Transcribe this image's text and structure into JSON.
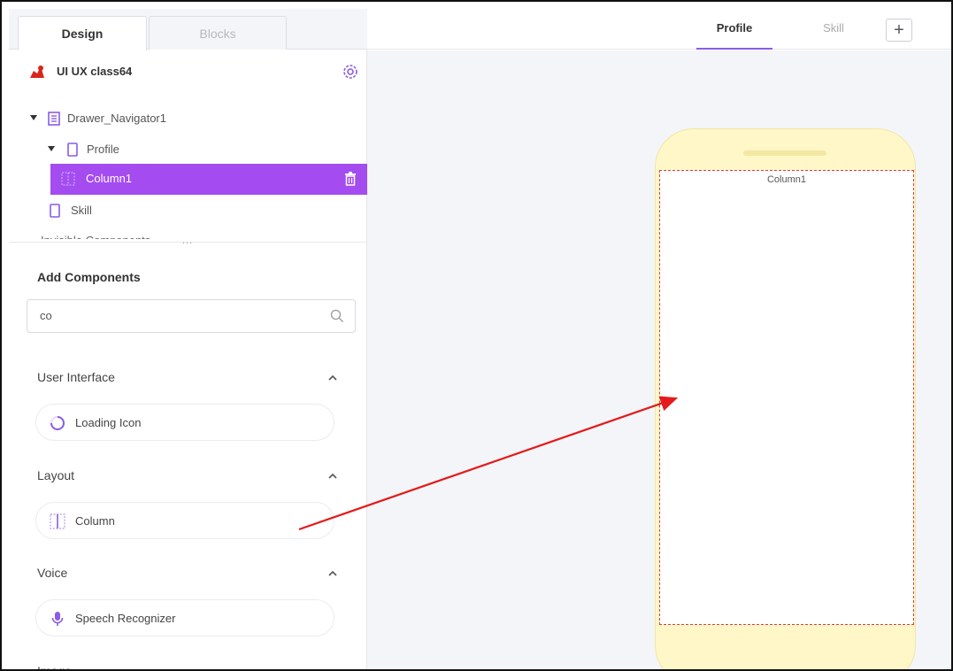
{
  "top_tabs": {
    "design": "Design",
    "blocks": "Blocks"
  },
  "project": {
    "name": "UI UX class64"
  },
  "tree": {
    "drawer": "Drawer_Navigator1",
    "profile": "Profile",
    "column1": "Column1",
    "skill": "Skill",
    "invisible": "Invisible Components",
    "dots": "..."
  },
  "add_components": {
    "title": "Add Components",
    "search_value": "co"
  },
  "categories": [
    {
      "title": "User Interface",
      "item": "Loading Icon"
    },
    {
      "title": "Layout",
      "item": "Column"
    },
    {
      "title": "Voice",
      "item": "Speech Recognizer"
    },
    {
      "title": "Image"
    }
  ],
  "screens": {
    "profile": "Profile",
    "skill": "Skill",
    "add": "+"
  },
  "canvas": {
    "component_label": "Column1"
  },
  "colors": {
    "accent": "#a44cf0",
    "arrow": "#e31b1b",
    "phone": "#fff7c7"
  }
}
